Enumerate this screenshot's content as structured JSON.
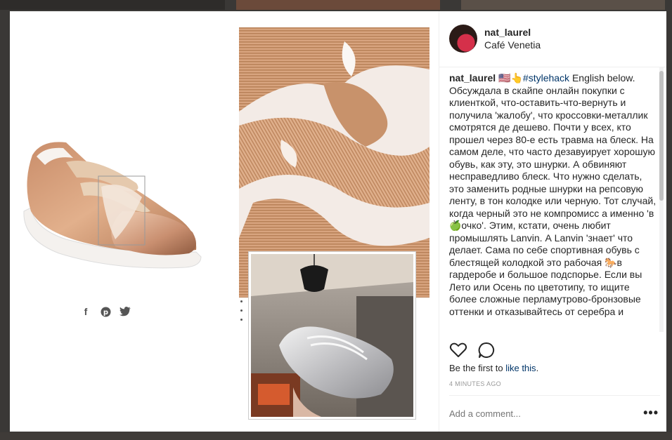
{
  "post": {
    "username": "nat_laurel",
    "location": "Café Venetia",
    "caption_user": "nat_laurel",
    "caption_flags": "🇺🇸👆",
    "caption_hashtag": "#stylehack",
    "caption_text": " English below. Обсуждала в скайпе онлайн покупки с клиенткой, что-оставить-что-вернуть и получила 'жалобу', что кроссовки-металлик смотрятся де дешево. Почти у всех, кто прошел через 80-е есть травма на блеск. На самом деле, что часто дезавуирует хорошую обувь, как эту, это шнурки. А обвиняют несправедливо блеск. Что нужно сделать, это заменить родные шнурки на репсовую ленту, в тон колодке или черную. Тот случай, когда черный это не компромисс а именно 'в 🍏очко'. Этим, кстати, очень любит промышлять Lanvin. А Lanvin 'знает' что делает. Сама по себе спортивная обувь с блестящей колодкой это рабочая 🐎в гардеробе и большое подспорье. Если вы Лето или Осень по цветотипу, то ищите более сложные перламутрово-бронзовые оттенки и отказывайтесь от серебра и"
  },
  "likes": {
    "prefix": "Be the first to ",
    "link": "like this",
    "suffix": "."
  },
  "timestamp": "4 MINUTES AGO",
  "comment": {
    "placeholder": "Add a comment..."
  },
  "more_label": "•••",
  "share_icons": [
    "facebook-icon",
    "pinterest-icon",
    "twitter-icon"
  ],
  "colors": {
    "text": "#262626",
    "link": "#003569",
    "muted": "#999999"
  }
}
